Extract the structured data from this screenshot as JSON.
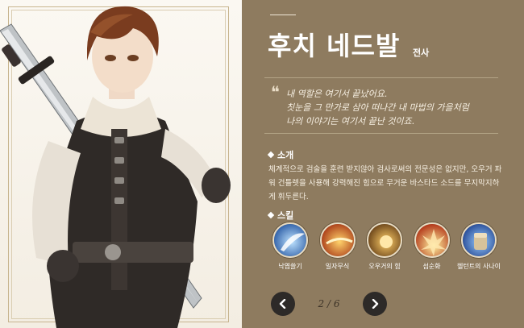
{
  "character": {
    "name": "후치 네드발",
    "class": "전사",
    "quote_mark": "❝",
    "quote": "내 역할은 여기서 끝났어요.\n칫눈을 그 만가로 삼아 떠나간 내 마법의 가을처럼\n나의 이야기는 여기서 끝난 것이죠."
  },
  "intro": {
    "title": "소개",
    "text": "체계적으로 검술을 훈련 받지않아 검사로써의 전문성은 없지만, 오우거 파워 건틀렛을 사용해 강력해진 힘으로 무거운 바스타드 소드를 무지막지하게 휘두른다."
  },
  "skills": {
    "title": "스킬",
    "items": [
      {
        "label": "낙엽쓸기",
        "icon": "leaf-sweep-icon",
        "color": "#3a7bd5"
      },
      {
        "label": "일자무식",
        "icon": "fire-slash-icon",
        "color": "#d9541e"
      },
      {
        "label": "오우거의 힘",
        "icon": "ogre-power-icon",
        "color": "#b8741a"
      },
      {
        "label": "섬순화",
        "icon": "flame-burst-icon",
        "color": "#e0662a"
      },
      {
        "label": "헬턴트의 사나이",
        "icon": "gauntlet-fist-icon",
        "color": "#2d63c8"
      }
    ]
  },
  "pager": {
    "text": "2 / 6",
    "prev_icon": "chevron-left-icon",
    "next_icon": "chevron-right-icon"
  },
  "colors": {
    "panel_bg": "#8e7b5f",
    "button_bg": "#2d2a28"
  }
}
